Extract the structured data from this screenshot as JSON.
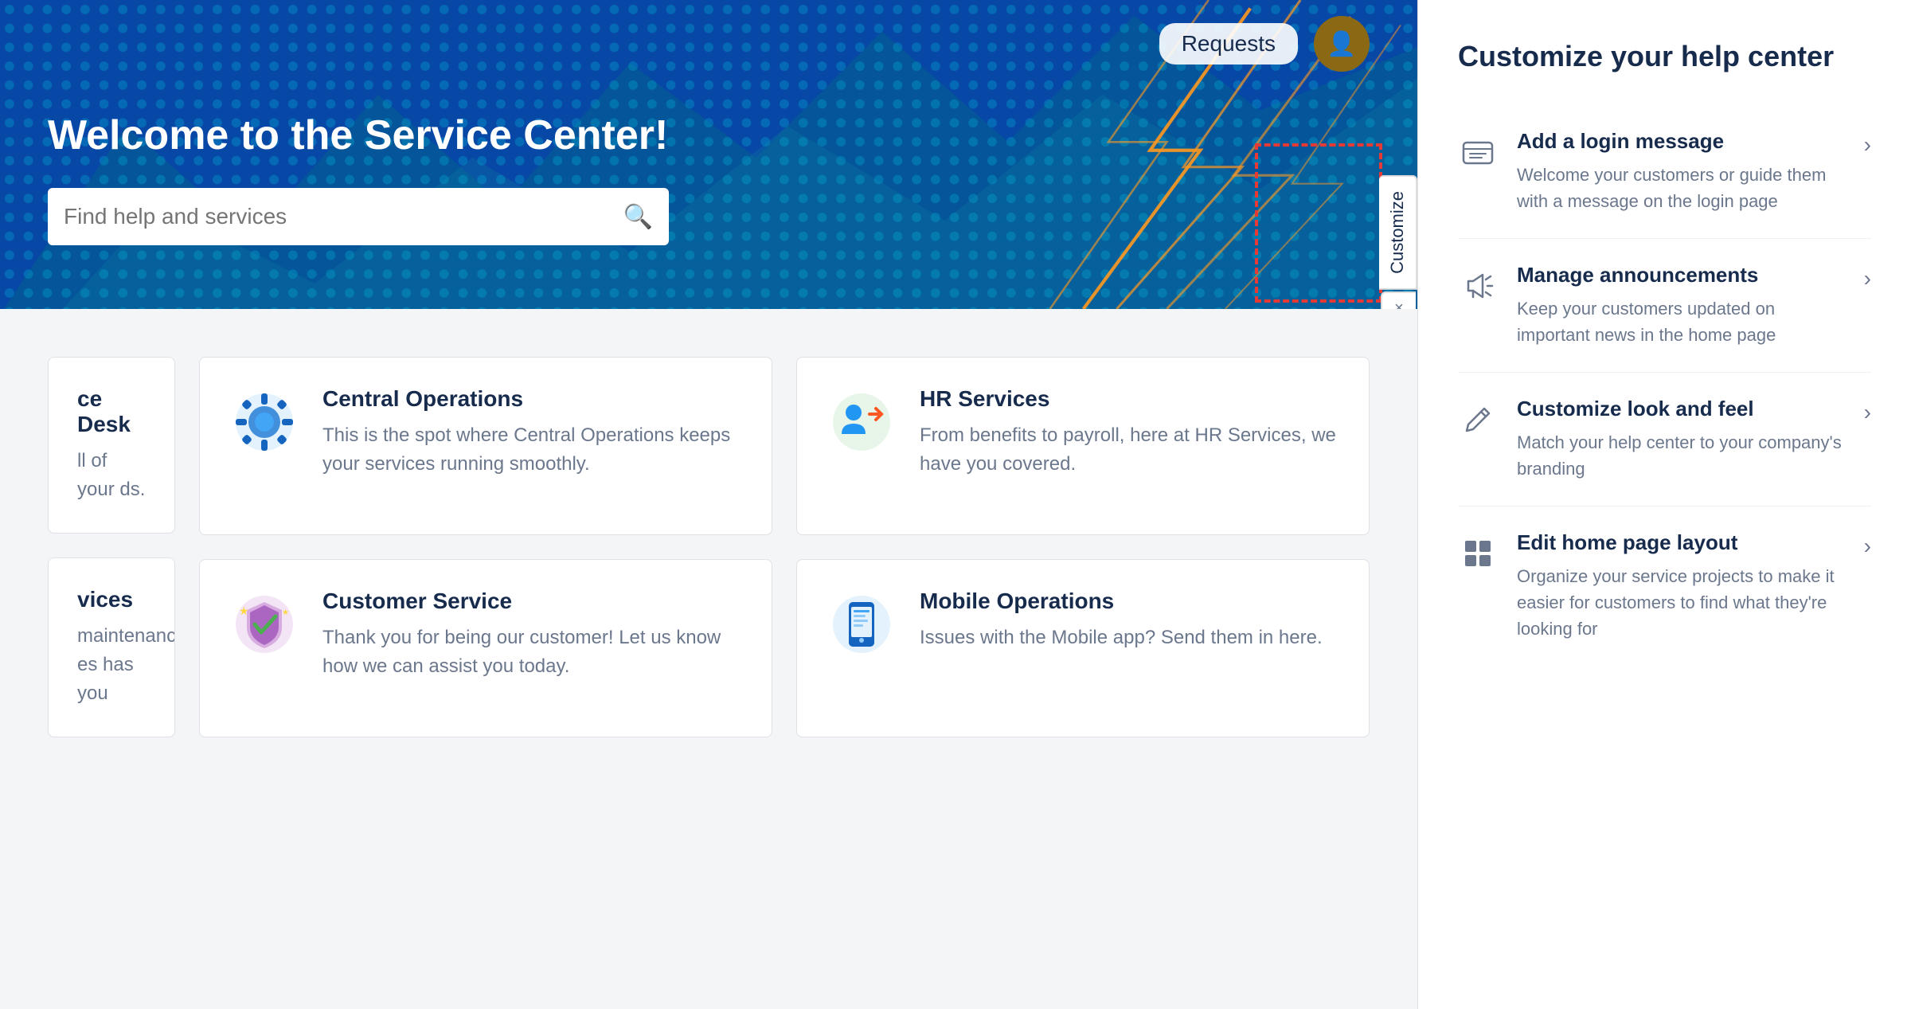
{
  "hero": {
    "title": "Welcome to the Service Center!",
    "search_placeholder": "Find help and services",
    "requests_btn": "Requests"
  },
  "customize_tab": {
    "label": "Customize",
    "close_label": "×"
  },
  "partial_cards": [
    {
      "name": "ce Desk",
      "desc": "ll of your\nds."
    },
    {
      "name": "vices",
      "desc": "maintenance,\nes has you"
    }
  ],
  "service_cards": [
    {
      "name": "Central Operations",
      "desc": "This is the spot where Central Operations keeps your services running smoothly.",
      "icon": "⚙️"
    },
    {
      "name": "HR Services",
      "desc": "From benefits to payroll, here at HR Services, we have you covered.",
      "icon": "🎯"
    },
    {
      "name": "Customer Service",
      "desc": "Thank you for being our customer! Let us know how we can assist you today.",
      "icon": "🛡️"
    },
    {
      "name": "Mobile Operations",
      "desc": "Issues with the Mobile app? Send them in here.",
      "icon": "📱"
    }
  ],
  "sidebar": {
    "title": "Customize your help center",
    "items": [
      {
        "id": "login-message",
        "title": "Add a login message",
        "desc": "Welcome your customers or guide them with a message on the login page",
        "icon": "💬"
      },
      {
        "id": "announcements",
        "title": "Manage announcements",
        "desc": "Keep your customers updated on important news in the home page",
        "icon": "📢"
      },
      {
        "id": "look-and-feel",
        "title": "Customize look and feel",
        "desc": "Match your help center to your company's branding",
        "icon": "✏️"
      },
      {
        "id": "home-page-layout",
        "title": "Edit home page layout",
        "desc": "Organize your service projects to make it easier for customers to find what they're looking for",
        "icon": "⊞"
      }
    ]
  }
}
